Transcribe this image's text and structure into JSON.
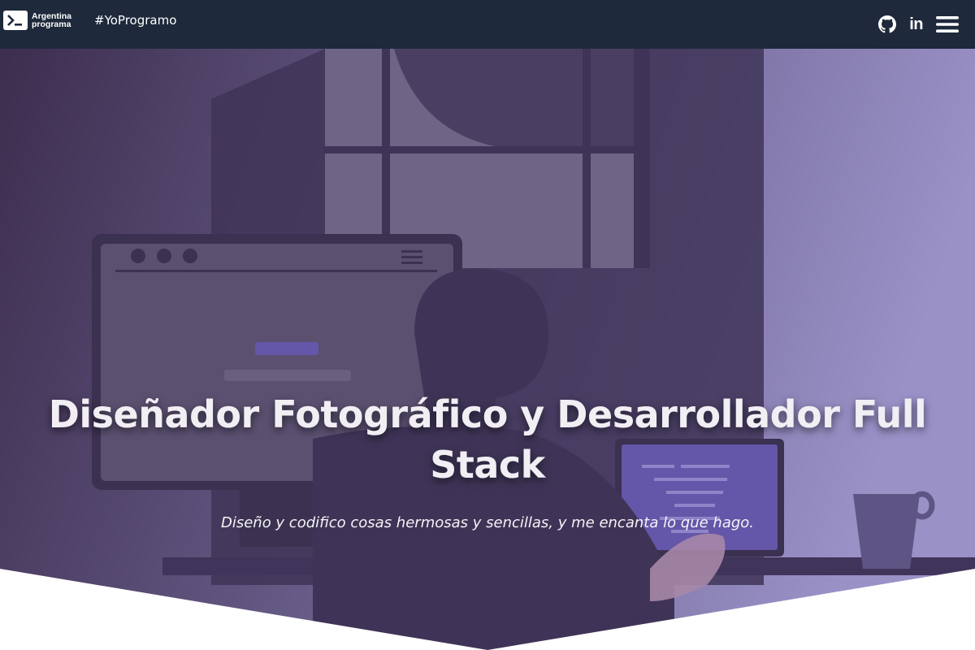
{
  "navbar": {
    "brand": {
      "line1": "Argentina",
      "line2": "programa",
      "icon": "terminal-icon"
    },
    "hashtag": "#YoProgramo",
    "icons": {
      "github": "github-icon",
      "linkedin": "linkedin-icon",
      "linkedin_text": "in",
      "menu": "hamburger-menu-icon"
    }
  },
  "hero": {
    "title": "Diseñador Fotográfico y Desarrollador Full Stack",
    "subtitle": "Diseño y codifico cosas hermosas y sencillas, y me encanta lo que hago.",
    "scroll_icon": "chevron-double-down-icon"
  },
  "colors": {
    "navbar_bg": "#1e293b",
    "accent_purple": "#6456a8",
    "hero_overlay_start": "#3d2e4f",
    "hero_overlay_end": "#9a91c7"
  }
}
